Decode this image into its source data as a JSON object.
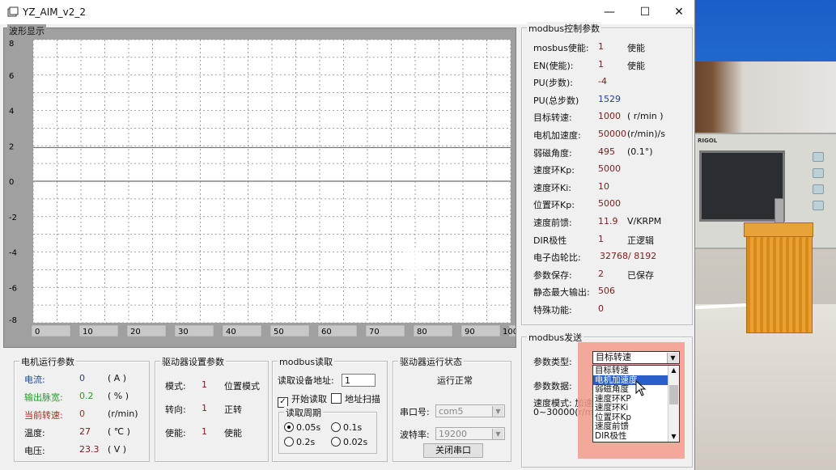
{
  "window": {
    "title": "YZ_AIM_v2_2",
    "minimize": "—",
    "maximize": "☐",
    "close": "✕"
  },
  "waveform": {
    "label": "波形显示",
    "y_ticks": [
      "8",
      "6",
      "4",
      "2",
      "0",
      "-2",
      "-4",
      "-6",
      "-8"
    ],
    "x_ticks": [
      "0",
      "10",
      "20",
      "30",
      "40",
      "50",
      "60",
      "70",
      "80",
      "90",
      "100"
    ]
  },
  "chart_data": {
    "type": "line",
    "title": "波形显示",
    "xlim": [
      0,
      100
    ],
    "ylim": [
      -8,
      8
    ],
    "grid": true,
    "series": [
      {
        "values_x": [
          0,
          100
        ],
        "values_y": [
          1.9,
          1.9
        ],
        "color": "#707070"
      },
      {
        "values_x": [
          0,
          100
        ],
        "values_y": [
          0,
          0
        ],
        "color": "#707070"
      }
    ]
  },
  "motor_params": {
    "label": "电机运行参数",
    "rows": [
      {
        "name": "电流:",
        "value": "0",
        "unit": "( A )",
        "color": "#1f3fa8",
        "valcolor": "#1f3fa8"
      },
      {
        "name": "输出脉宽:",
        "value": "0.2",
        "unit": "( % )",
        "color": "#22a022",
        "valcolor": "#22a022"
      },
      {
        "name": "当前转速:",
        "value": "0",
        "unit": "(r/min)",
        "color": "#c02020",
        "valcolor": "#c02020"
      },
      {
        "name": "温度:",
        "value": "27",
        "unit": "( ℃ )",
        "color": "#111111",
        "valcolor": "#7a1c1c"
      },
      {
        "name": "电压:",
        "value": "23.3",
        "unit": "( V )",
        "color": "#111111",
        "valcolor": "#7a1c1c"
      }
    ]
  },
  "driver_settings": {
    "label": "驱动器设置参数",
    "rows": [
      {
        "name": "模式:",
        "value": "1",
        "desc": "位置模式"
      },
      {
        "name": "转向:",
        "value": "1",
        "desc": "正转"
      },
      {
        "name": "使能:",
        "value": "1",
        "desc": "使能"
      }
    ]
  },
  "modbus_read": {
    "label": "modbus读取",
    "addr_label": "读取设备地址:",
    "addr_value": "1",
    "start_read": "开始读取",
    "addr_scan": "地址扫描",
    "period_label": "读取周期",
    "periods": [
      "0.05s",
      "0.1s",
      "0.2s",
      "0.02s"
    ],
    "selected_period": "0.05s"
  },
  "driver_status": {
    "label": "驱动器运行状态",
    "status": "运行正常",
    "port_label": "串口号:",
    "port_value": "com5",
    "baud_label": "波特率:",
    "baud_value": "19200",
    "close_port": "关闭串口"
  },
  "modbus_control": {
    "label": "modbus控制参数",
    "rows": [
      {
        "name": "mosbus使能:",
        "value": "1",
        "unit": "使能"
      },
      {
        "name": "EN(使能):",
        "value": "1",
        "unit": "使能"
      },
      {
        "name": "PU(步数):",
        "value": "-4",
        "unit": ""
      },
      {
        "name": "PU(总步数)",
        "value": "1529",
        "unit": ""
      },
      {
        "name": "目标转速:",
        "value": "1000",
        "unit": "( r/min )"
      },
      {
        "name": "电机加速度:",
        "value": "50000",
        "unit": "(r/min)/s"
      },
      {
        "name": "弱磁角度:",
        "value": "495",
        "unit": "(0.1°)"
      },
      {
        "name": "速度环Kp:",
        "value": "5000",
        "unit": ""
      },
      {
        "name": "速度环Ki:",
        "value": "10",
        "unit": ""
      },
      {
        "name": "位置环Kp:",
        "value": "5000",
        "unit": ""
      },
      {
        "name": "速度前馈:",
        "value": "11.9",
        "unit": "V/KRPM"
      },
      {
        "name": "DIR极性",
        "value": "1",
        "unit": "正逻辑"
      },
      {
        "name": "电子齿轮比:",
        "value": "32768/ 8192",
        "unit": ""
      },
      {
        "name": "参数保存:",
        "value": "2",
        "unit": "已保存"
      },
      {
        "name": "静态最大输出:",
        "value": "506",
        "unit": ""
      },
      {
        "name": "特殊功能:",
        "value": "0",
        "unit": ""
      }
    ]
  },
  "modbus_send": {
    "label": "modbus发送",
    "param_type_label": "参数类型:",
    "param_type_value": "目标转速",
    "param_data_label": "参数数据:",
    "hint_line1": "速度模式: 加速",
    "hint_line2": "0~30000(r/min)/",
    "options": [
      "目标转速",
      "电机加速度",
      "弱磁角度",
      "速度环KP",
      "速度环Ki",
      "位置环Kp",
      "速度前馈",
      "DIR极性"
    ],
    "highlighted": "电机加速度",
    "highlight_color": "#f08a7a"
  }
}
